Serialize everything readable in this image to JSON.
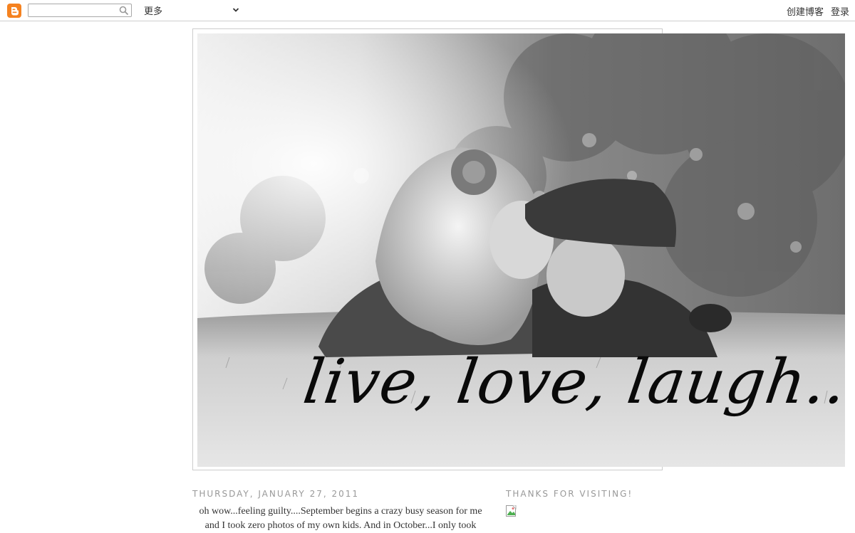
{
  "navbar": {
    "logo_icon": "blogger-logo-icon",
    "search_placeholder": "",
    "search_icon": "search-icon",
    "more_label": "更多",
    "create_blog_label": "创建博客",
    "login_label": "登录",
    "brand_color": "#f58220"
  },
  "header": {
    "tagline": "live, love, laugh..."
  },
  "post": {
    "date": "THURSDAY, JANUARY 27, 2011",
    "lines": [
      "oh wow...feeling guilty....September begins a crazy busy season for me",
      "and I took zero photos of my own kids. And in October...I only took"
    ]
  },
  "sidebar": {
    "title": "THANKS FOR VISITING!",
    "image_icon": "broken-image-icon"
  }
}
